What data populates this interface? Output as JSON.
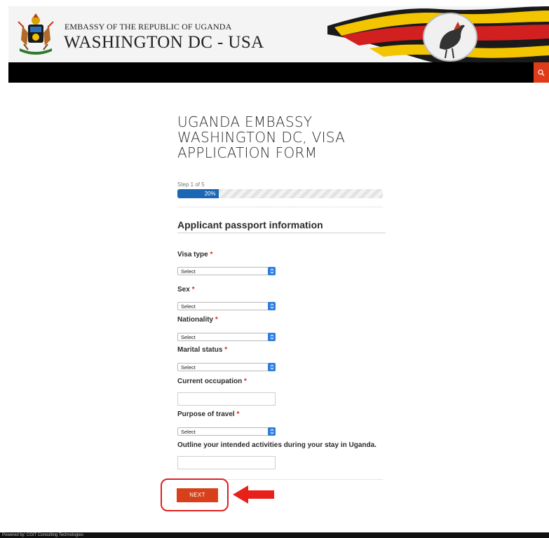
{
  "header": {
    "embassy_line": "EMBASSY OF THE REPUBLIC OF UGANDA",
    "location_line": "WASHINGTON DC - USA"
  },
  "nav": {
    "search_icon": "search-icon",
    "accent_color": "#e03b18"
  },
  "form": {
    "title": "UGANDA EMBASSY WASHINGTON DC, VISA APPLICATION FORM",
    "step_label": "Step 1 of 5",
    "progress_percent": 20,
    "progress_text": "20%",
    "section_title": "Applicant passport information",
    "fields": {
      "visa_type": {
        "label": "Visa type",
        "value": "Select"
      },
      "sex": {
        "label": "Sex",
        "value": "Select"
      },
      "nationality": {
        "label": "Nationality",
        "value": "Select"
      },
      "marital_status": {
        "label": "Marital status",
        "value": "Select"
      },
      "occupation": {
        "label": "Current occupation",
        "value": ""
      },
      "purpose": {
        "label": "Purpose of travel",
        "value": "Select"
      },
      "activities": {
        "label": "Outline your intended activities during your stay in Uganda.",
        "value": ""
      }
    },
    "required_mark": "*",
    "next_label": "NEXT"
  },
  "footer": {
    "text": "Powered by: CGIT Consulting Technologies"
  }
}
